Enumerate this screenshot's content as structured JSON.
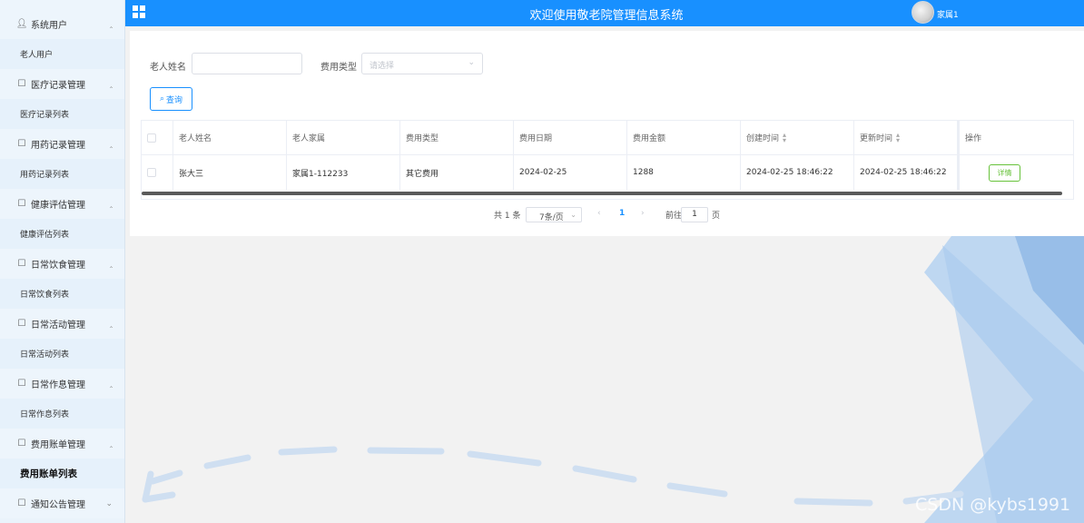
{
  "sidebar": {
    "groups": [
      {
        "title": "系统用户",
        "icon": "user-icon",
        "sub": "老人用户"
      },
      {
        "title": "医疗记录管理",
        "icon": "doc-icon",
        "sub": "医疗记录列表"
      },
      {
        "title": "用药记录管理",
        "icon": "doc-icon",
        "sub": "用药记录列表"
      },
      {
        "title": "健康评估管理",
        "icon": "doc-icon",
        "sub": "健康评估列表"
      },
      {
        "title": "日常饮食管理",
        "icon": "doc-icon",
        "sub": "日常饮食列表"
      },
      {
        "title": "日常活动管理",
        "icon": "doc-icon",
        "sub": "日常活动列表"
      },
      {
        "title": "日常作息管理",
        "icon": "doc-icon",
        "sub": "日常作息列表"
      },
      {
        "title": "费用账单管理",
        "icon": "doc-icon",
        "sub": "费用账单列表"
      }
    ],
    "last_group": "通知公告管理"
  },
  "header": {
    "title": "欢迎使用敬老院管理信息系统",
    "user": "家属1"
  },
  "search": {
    "name_label": "老人姓名",
    "name_value": "",
    "type_label": "费用类型",
    "type_placeholder": "请选择",
    "query_label": "查询"
  },
  "table": {
    "columns": [
      "老人姓名",
      "老人家属",
      "费用类型",
      "费用日期",
      "费用金额",
      "创建时间",
      "更新时间",
      "操作"
    ],
    "rows": [
      {
        "name": "张大三",
        "family": "家属1-112233",
        "type": "其它费用",
        "date": "2024-02-25",
        "amount": "1288",
        "created": "2024-02-25 18:46:22",
        "updated": "2024-02-25 18:46:22",
        "action": "详情"
      }
    ]
  },
  "pagination": {
    "total": "共 1 条",
    "page_size": "7条/页",
    "current": "1",
    "goto_label": "前往",
    "goto_value": "1",
    "page_unit": "页"
  },
  "watermark": "CSDN @kybs1991",
  "colors": {
    "primary": "#1890ff",
    "success": "#67c23a",
    "sidebar_bg": "#eaf3fb"
  }
}
